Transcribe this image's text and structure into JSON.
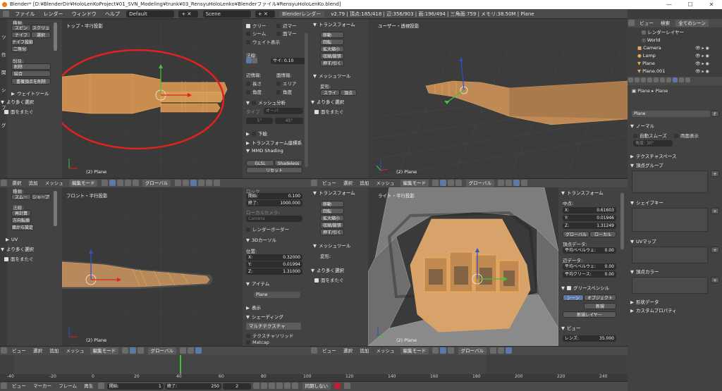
{
  "title_bar": {
    "text": "Blender* [D:¥BlenderDir¥HoloLenKoProject¥01_SVN_Modeling¥trunk¥03_RensyuHoloLenko¥Blenderファイル¥RensyuHoloLenKo.blend]",
    "minimize": "—",
    "maximize": "☐",
    "close": "✕"
  },
  "top_menu": {
    "items": [
      "ファイル",
      "レンダー",
      "ウィンドウ",
      "ヘルプ"
    ],
    "layout": "Default",
    "scene": "Scene",
    "engine": "Blenderレンダー",
    "stats": "v2.79 | 頂点:185/418 | 辺:356/903 | 面:196/494 | 三角面:759 | メモリ:38.50M | Plane"
  },
  "tools_top": {
    "row0": "種類:",
    "spin": "スピン",
    "screw": "スクリュ",
    "knife": "ナイフ",
    "select": "選択",
    "knife_project": "ナイフ投影",
    "bisect": "二等分",
    "remove_label": "削除:",
    "delete": "削除",
    "join": "結合",
    "remove_doubles": "重複頂点を削除",
    "weight_tools": "ウェイトツール",
    "select_more": "より多く選択",
    "face_select": "面をまたぐ",
    "tabs": [
      "ツ",
      "作",
      "関",
      "シ",
      "プ",
      "グ"
    ]
  },
  "vp_top": {
    "label": "トップ・平行投影",
    "obj": "(2) Plane"
  },
  "props_top": {
    "cleave": "クリー",
    "edge_mark": "辺マー",
    "seam": "シーム",
    "face_mark": "面マー",
    "weight_display": "ウェイト表示",
    "normals_label": "法線:",
    "size_label": "サイ: 0.10",
    "stats_label": "辺情報:",
    "face_info": "面情報:",
    "length": "長さ",
    "area": "エリア",
    "angle": "角度",
    "angle2": "角度",
    "mesh_analysis": "メッシュ分析",
    "type_label": "タイプ",
    "type_val": "オーバ",
    "range1": "5°",
    "range2": "45°",
    "shadow": "下絵",
    "transform_orient": "トランスフォーム座標系",
    "mmd": "MMD Shading",
    "glsl": "GLSL",
    "shadeless": "Shadeless",
    "reset": "リセット"
  },
  "tools_user": {
    "transform": "トランスフォーム",
    "move": "移動",
    "rotate": "回転",
    "scale": "拡大縮小",
    "shrink": "収縮/膨張",
    "push": "押す/引く",
    "mesh_tools": "メッシュツール",
    "deform": "変形:",
    "slide": "スライ",
    "vertex": "頂点",
    "more": "より多く選択",
    "face_select": "面をまたぐ"
  },
  "vp_user": {
    "label": "ユーザー・透視投影",
    "obj": "(2) Plane"
  },
  "outliner": {
    "view": "ビュー",
    "search": "検索",
    "all_scenes": "全てのシーン",
    "items": [
      "レンダーレイヤー",
      "World",
      "Camera",
      "Lamp",
      "Plane",
      "Plane.001"
    ]
  },
  "prop_editor": {
    "breadcrumb1": "Plane",
    "breadcrumb2": "Plane",
    "mesh_name": "Plane",
    "fake": "F",
    "normal": "ノーマル",
    "auto_smooth": "自動スムーズ",
    "double_sided": "両面表示",
    "angle_field": "角度:",
    "angle_value": "30°",
    "texture_space": "テクスチャスペース",
    "vertex_groups": "頂点グループ",
    "shape_keys": "シェイプキー",
    "uv_maps": "UVマップ",
    "vertex_colors": "頂点カラー",
    "geometry_data": "形状データ",
    "custom_props": "カスタムプロパティ"
  },
  "header_mid": {
    "view": "ビュー",
    "select": "選択",
    "add": "追加",
    "mesh": "メッシュ",
    "mode": "編集モード",
    "global": "グローバル"
  },
  "tools_front": {
    "row0": "種類:",
    "smooth": "スムー",
    "sharp": "シャープ",
    "normals_label": "法線:",
    "recalc": "再計算",
    "flip": "方向転換",
    "set_from_faces": "面から設定",
    "uv": "UV",
    "more": "より多く選択",
    "face_select": "面をまたぐ"
  },
  "vp_front": {
    "label": "フロント・平行投影",
    "obj": "(2) Plane"
  },
  "props_front": {
    "lock_label": "ロック",
    "clip_start": "開始:",
    "clip_start_val": "0.100",
    "clip_end": "終了:",
    "clip_end_val": "1000.000",
    "local_camera": "ローカルカメラ:",
    "camera": "Camera",
    "render_border": "レンダーボーダー",
    "cursor": "3Dカーソル",
    "location": "位置:",
    "x": "X:",
    "x_val": "0.32000",
    "y": "Y:",
    "y_val": "0.01994",
    "z": "Z:",
    "z_val": "1.31000",
    "item": "アイテム",
    "item_name": "Plane",
    "display": "表示",
    "shading": "シェーディング",
    "multitexture": "マルチテクスチャ",
    "texture_solid": "テクスチャソリッド",
    "matcap": "Matcap"
  },
  "tools_right": {
    "transform": "トランスフォーム",
    "move": "移動",
    "rotate": "回転",
    "scale": "拡大縮小",
    "shrink": "収縮/膨張",
    "push": "押す/引く",
    "mesh_tools": "メッシュツール",
    "deform": "変形:",
    "more": "より多く選択",
    "face_select": "面をまたぐ"
  },
  "vp_right": {
    "label": "ライト・平行投影",
    "obj": "(2) Plane"
  },
  "props_right": {
    "transform": "トランスフォーム",
    "median": "中点:",
    "x": "X:",
    "x_val": "0.61603",
    "y": "Y:",
    "y_val": "0.01946",
    "z": "Z:",
    "z_val": "1.31249",
    "global": "グローバル",
    "local": "ローカル",
    "vertex_data": "頂点データ:",
    "bevel_weight": "平均ベベルウェ:",
    "bevel_weight_val": "0.00",
    "edge_data": "辺データ:",
    "edge_bevel": "平均ベベルウェ:",
    "edge_bevel_val": "0.00",
    "crease": "平均クリース:",
    "crease_val": "0.00",
    "grease_pencil": "グリースペンシル",
    "scene": "シーン",
    "object": "オブジェクト",
    "new": "新規",
    "new_layer": "新規レイヤー",
    "view": "ビュー",
    "lens": "レンズ:",
    "lens_val": "35.000"
  },
  "timeline": {
    "view": "ビュー",
    "marker": "マーカー",
    "frame": "フレーム",
    "playback": "再生",
    "start_label": "開始:",
    "start_val": "1",
    "end_label": "終了:",
    "end_val": "250",
    "current_val": "2",
    "sync": "同期しない",
    "ticks": [
      "-40",
      "-20",
      "0",
      "20",
      "40",
      "60",
      "80",
      "100",
      "120",
      "140",
      "160",
      "180",
      "200",
      "220",
      "240",
      "260"
    ]
  },
  "colors": {
    "mesh": "#e3a860",
    "selected_edge": "#ffb347",
    "annotation": "#e0231c",
    "active_tab": "#5b7aa7"
  }
}
